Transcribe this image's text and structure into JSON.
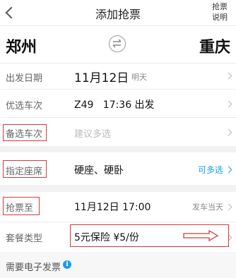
{
  "header": {
    "title": "添加抢票",
    "right_line1": "抢票",
    "right_line2": "说明"
  },
  "route": {
    "from_city": "郑州",
    "to_city": "重庆"
  },
  "rows": {
    "departure_date": {
      "label": "出发日期",
      "value": "11月12日",
      "sub": "明天"
    },
    "preferred_train": {
      "label": "优选车次",
      "value": "Z49   17:36 出发"
    },
    "backup_train": {
      "label": "备选车次",
      "placeholder": "建议多选"
    },
    "seat_type": {
      "label": "指定座席",
      "value": "硬座、硬卧",
      "action": "可多选"
    },
    "grab_until": {
      "label": "抢票至",
      "value": "11月12日 17:00",
      "hint": "发车当天"
    },
    "package_type": {
      "label": "套餐类型",
      "value": "5元保险 ¥5/份"
    },
    "invoice": {
      "label": "需要电子发票",
      "info": "i"
    }
  },
  "colors": {
    "accent": "#1aa0e6",
    "highlight_box": "#d23a3a"
  }
}
